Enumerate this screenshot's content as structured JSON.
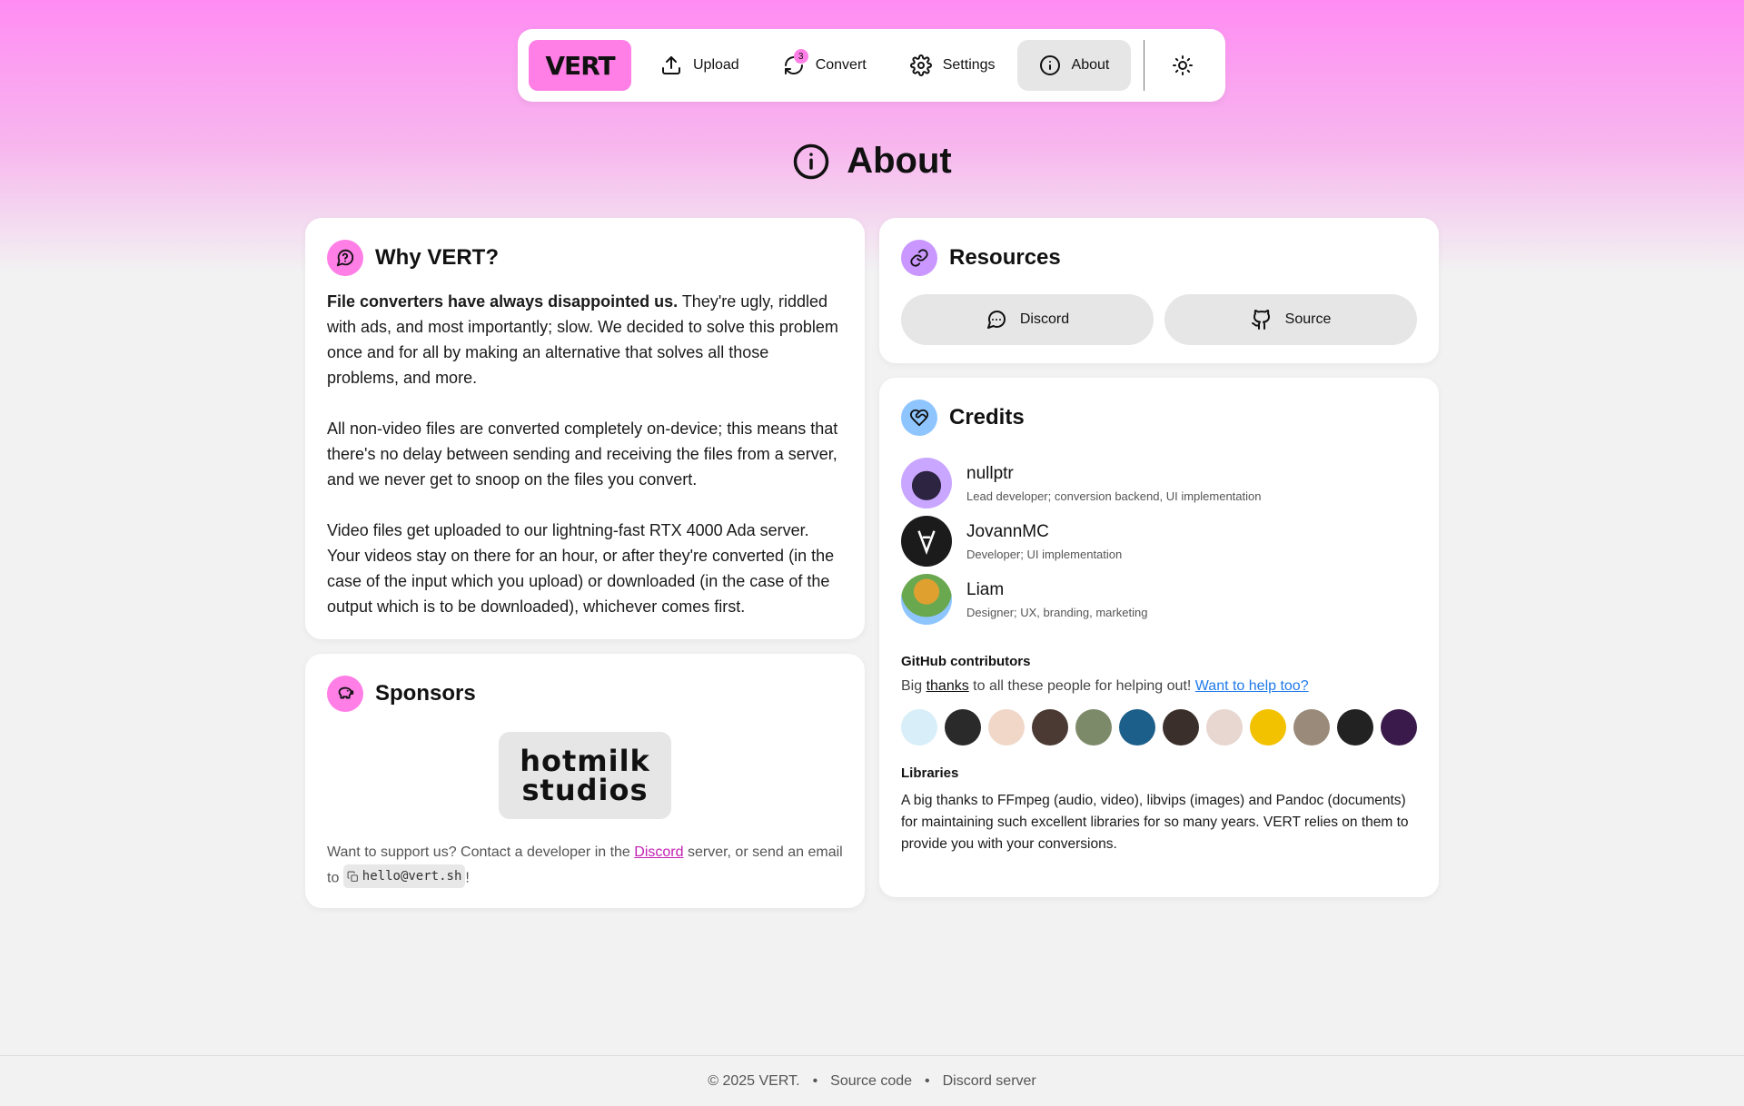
{
  "nav": {
    "logo": "VERT",
    "items": [
      {
        "label": "Upload",
        "icon": "upload-icon"
      },
      {
        "label": "Convert",
        "icon": "refresh-icon",
        "badge": "3"
      },
      {
        "label": "Settings",
        "icon": "gear-icon"
      },
      {
        "label": "About",
        "icon": "info-icon",
        "active": true
      }
    ],
    "theme_icon": "sun-icon"
  },
  "page": {
    "title": "About"
  },
  "why": {
    "title": "Why VERT?",
    "p1_bold": "File converters have always disappointed us.",
    "p1_rest": " They're ugly, riddled with ads, and most importantly; slow. We decided to solve this problem once and for all by making an alternative that solves all those problems, and more.",
    "p2": "All non-video files are converted completely on-device; this means that there's no delay between sending and receiving the files from a server, and we never get to snoop on the files you convert.",
    "p3": "Video files get uploaded to our lightning-fast RTX 4000 Ada server. Your videos stay on there for an hour, or after they're converted (in the case of the input which you upload) or downloaded (in the case of the output which is to be downloaded), whichever comes first."
  },
  "sponsors": {
    "title": "Sponsors",
    "logo_line1": "hotmilk",
    "logo_line2": "studios",
    "text_before": "Want to support us? Contact a developer in the ",
    "link": "Discord",
    "text_after": " server, or send an email to ",
    "email": "hello@vert.sh",
    "end": "!"
  },
  "resources": {
    "title": "Resources",
    "buttons": [
      {
        "label": "Discord",
        "icon": "discord-icon"
      },
      {
        "label": "Source",
        "icon": "github-icon"
      }
    ]
  },
  "credits": {
    "title": "Credits",
    "people": [
      {
        "name": "nullptr",
        "role": "Lead developer; conversion backend, UI implementation"
      },
      {
        "name": "JovannMC",
        "role": "Developer; UI implementation"
      },
      {
        "name": "Liam",
        "role": "Designer; UX, branding, marketing"
      }
    ],
    "contributors_heading": "GitHub contributors",
    "contrib_text_1": "Big ",
    "contrib_thanks": "thanks",
    "contrib_text_2": " to all these people for helping out! ",
    "contrib_link": "Want to help too?",
    "contributor_colors": [
      "#d8eef8",
      "#2a2a2a",
      "#f0d7c8",
      "#4a3a33",
      "#7d8a6a",
      "#1c5f8a",
      "#3b2f2b",
      "#e8d6d0",
      "#f2c200",
      "#9a8a7a",
      "#222222",
      "#3a1a4a"
    ],
    "libraries_heading": "Libraries",
    "libraries_text": "A big thanks to FFmpeg (audio, video), libvips (images) and Pandoc (documents) for maintaining such excellent libraries for so many years. VERT relies on them to provide you with your conversions."
  },
  "footer": {
    "copyright": "© 2025 VERT.",
    "sep": "•",
    "source": "Source code",
    "discord": "Discord server"
  }
}
